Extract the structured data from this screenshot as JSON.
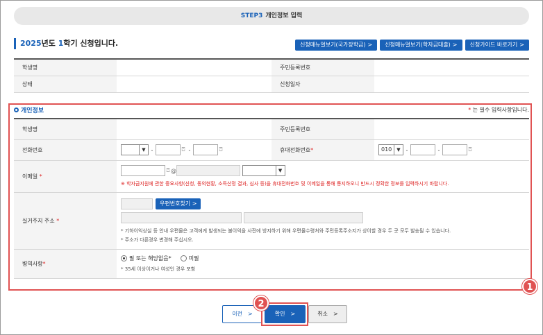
{
  "stepbar": {
    "step": "STEP3",
    "title": "개인정보 입력"
  },
  "semester": {
    "year": "2025",
    "year_suffix": "년도 ",
    "term": "1",
    "term_suffix": "학기 신청입니다."
  },
  "top_buttons": [
    {
      "label": "신청매뉴얼보기(국가장학금)",
      "chev": ">"
    },
    {
      "label": "신청매뉴얼보기(학자금대출)",
      "chev": ">"
    },
    {
      "label": "신청가이드 바로가기",
      "chev": ">"
    }
  ],
  "info": {
    "student_name_label": "학생명",
    "student_name_value": "",
    "rrn_label": "주민등록번호",
    "rrn_value": "",
    "status_label": "상태",
    "status_value": "",
    "apply_date_label": "신청일자",
    "apply_date_value": ""
  },
  "section": {
    "title": "개인정보",
    "required_star": "*",
    "required_note": " 는 필수 입력사항입니다."
  },
  "form": {
    "student_name_label": "학생명",
    "rrn_label": "주민등록번호",
    "phone_label": "전화번호",
    "phone_dash": "-",
    "mobile_label": "휴대전화번호",
    "mobile_star": "*",
    "mobile_prefix": "010",
    "email_label": "이메일",
    "email_star": "*",
    "email_at": "@",
    "email_warning": "※ 학자금지원에 관한 중요사항(신청, 동의현황, 소득산정 결과, 심사 등)을 휴대전화번호 및 이메일을 통해 통지하오니 반드시 정확한 정보를 입력하시기 바랍니다.",
    "address_label": "실거주지 주소",
    "address_star": "*",
    "zip_button": "우편번호찾기",
    "zip_chev": ">",
    "address_note1": "* 기하이익상실 등 안내 우편물은 고객에게 발생되는 불이익을 사전에 방지하기 위해 우편물수령처와 주민등록주소지가 상이할 경우 두 곳 모두 발송될 수 있습니다.",
    "address_note2": "* 주소가 다른경우 변경해 주십시오.",
    "military_label": "병역사항",
    "military_star": "*",
    "military_option1": "필 또는 해당없음*",
    "military_option2": "미필",
    "military_note": "* 35세 이상이거나 여성인 경우 포함"
  },
  "buttons": {
    "prev": "이전",
    "confirm": "확인",
    "cancel": "취소",
    "chev": ">"
  },
  "badges": {
    "one": "1",
    "two": "2"
  },
  "colors": {
    "accent": "#1a62b8",
    "highlight": "#e05252",
    "required": "#dd2222"
  },
  "icons": [
    "chevron-right-icon",
    "mouse-icon",
    "select-arrow-icon"
  ]
}
